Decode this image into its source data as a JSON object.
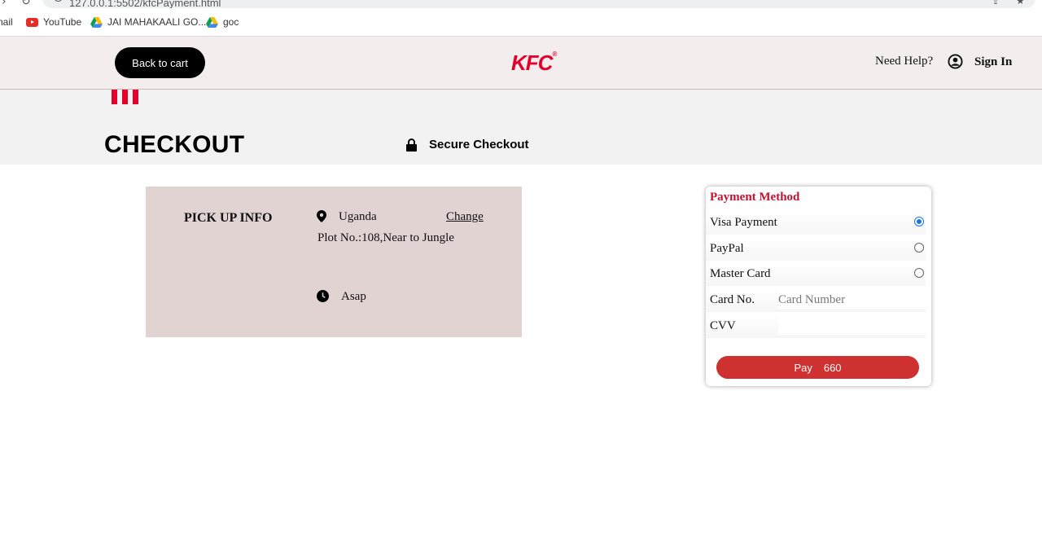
{
  "browser": {
    "url": "127.0.0.1:5502/kfcPayment.html",
    "bookmarks": [
      {
        "label": "nail",
        "icon": "gmail-icon"
      },
      {
        "label": "YouTube",
        "icon": "youtube-icon"
      },
      {
        "label": "JAI MAHAKAALI GO...",
        "icon": "drive-icon"
      },
      {
        "label": "goc",
        "icon": "drive-icon"
      }
    ]
  },
  "header": {
    "back_label": "Back to cart",
    "logo_text": "KFC",
    "help_label": "Need Help?",
    "signin_label": "Sign In"
  },
  "checkout": {
    "title": "CHECKOUT",
    "secure_label": "Secure Checkout"
  },
  "pickup": {
    "title": "PICK UP INFO",
    "location": "Uganda",
    "change_label": "Change",
    "address": "Plot No.:108,Near to Jungle",
    "time": "Asap"
  },
  "payment": {
    "title": "Payment Method",
    "options": [
      {
        "label": "Visa Payment",
        "selected": true
      },
      {
        "label": "PayPal",
        "selected": false
      },
      {
        "label": "Master Card",
        "selected": false
      }
    ],
    "card_label": "Card No.",
    "card_placeholder": "Card Number",
    "cvv_label": "CVV",
    "cvv_value": "",
    "pay_label": "Pay",
    "amount": "660"
  },
  "colors": {
    "brand_red": "#e4002b",
    "pay_button": "#cf3030",
    "header_bg": "#f3eded",
    "pickup_bg": "#e0d3d2"
  }
}
